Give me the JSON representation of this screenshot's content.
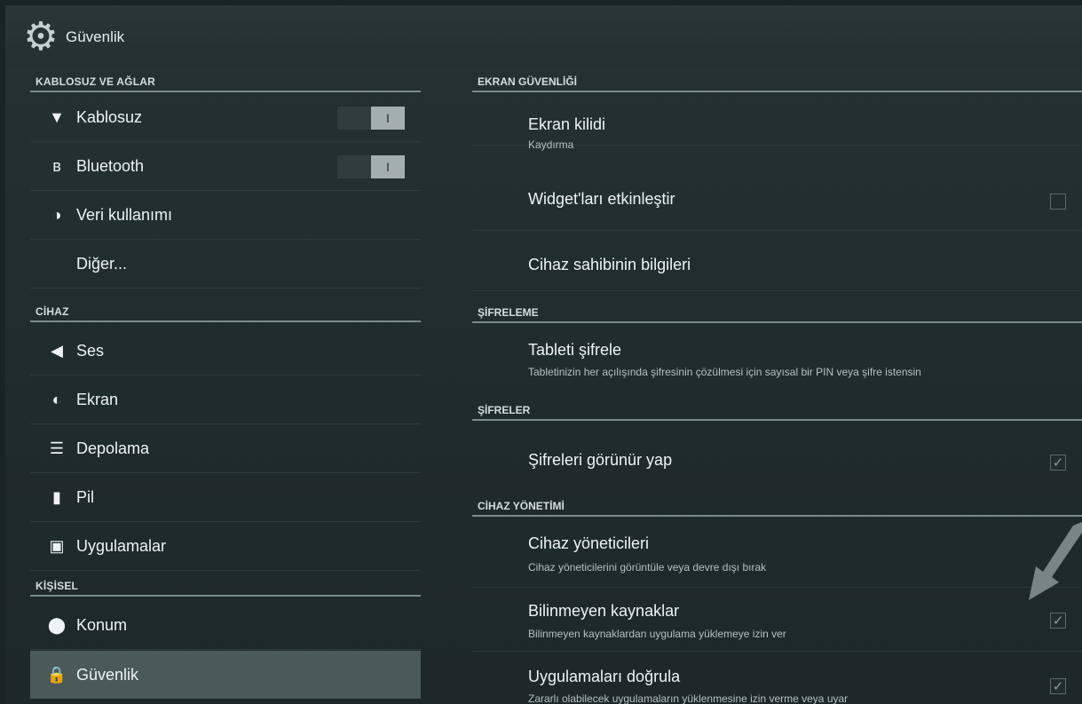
{
  "app": {
    "title": "Güvenlik",
    "icon": "gear-icon"
  },
  "left": {
    "sections": {
      "wireless": "KABLOSUZ VE AĞLAR",
      "device": "CİHAZ",
      "personal": "KİŞİSEL"
    },
    "items": {
      "wifi": {
        "label": "Kablosuz",
        "icon": "wifi-icon",
        "toggle": "I"
      },
      "bluetooth": {
        "label": "Bluetooth",
        "icon": "bluetooth-icon",
        "toggle": "I"
      },
      "data": {
        "label": "Veri kullanımı",
        "icon": "data-usage-icon"
      },
      "more": {
        "label": "Diğer..."
      },
      "sound": {
        "label": "Ses",
        "icon": "speaker-icon"
      },
      "display": {
        "label": "Ekran",
        "icon": "brightness-icon"
      },
      "storage": {
        "label": "Depolama",
        "icon": "storage-icon"
      },
      "battery": {
        "label": "Pil",
        "icon": "battery-icon"
      },
      "apps": {
        "label": "Uygulamalar",
        "icon": "apps-icon"
      },
      "location": {
        "label": "Konum",
        "icon": "location-pin-icon"
      },
      "security": {
        "label": "Güvenlik",
        "icon": "lock-icon",
        "selected": true
      }
    }
  },
  "right": {
    "sections": {
      "screen_security": "EKRAN GÜVENLİĞİ",
      "encryption": "ŞİFRELEME",
      "passwords": "ŞİFRELER",
      "device_admin": "CİHAZ YÖNETİMİ"
    },
    "items": {
      "screen_lock": {
        "title": "Ekran kilidi",
        "summary": "Kaydırma"
      },
      "widgets": {
        "title": "Widget'ları etkinleştir",
        "checked": false
      },
      "owner_info": {
        "title": "Cihaz sahibinin bilgileri"
      },
      "encrypt": {
        "title": "Tableti şifrele",
        "summary": "Tabletinizin her açılışında şifresinin çözülmesi için sayısal bir PIN veya şifre istensin"
      },
      "show_passwords": {
        "title": "Şifreleri görünür yap",
        "checked": true
      },
      "device_admins": {
        "title": "Cihaz yöneticileri",
        "summary": "Cihaz yöneticilerini görüntüle veya devre dışı bırak"
      },
      "unknown_sources": {
        "title": "Bilinmeyen kaynaklar",
        "summary": "Bilinmeyen kaynaklardan uygulama yüklemeye izin ver",
        "checked": true
      },
      "verify_apps": {
        "title": "Uygulamaları doğrula",
        "summary": "Zararlı olabilecek uygulamaların yüklenmesine izin verme veya uyar",
        "checked": true
      }
    },
    "check_glyph": "✓"
  },
  "colors": {
    "background": "#202b2b",
    "selected": "#4b5959",
    "divider": "#7b8a8a"
  }
}
